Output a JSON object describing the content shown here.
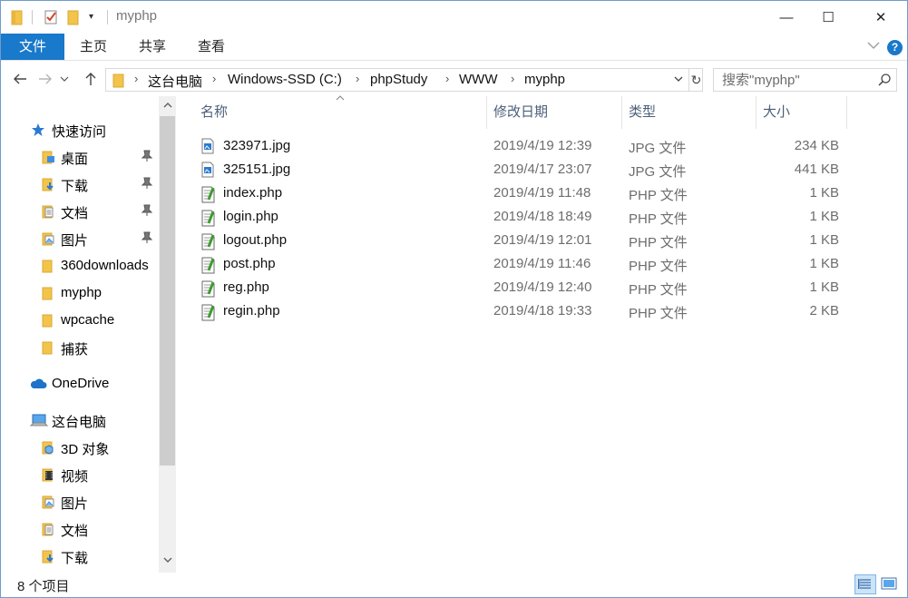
{
  "window": {
    "title": "myphp",
    "minimize_glyph": "—",
    "maximize_glyph": "☐",
    "close_glyph": "✕"
  },
  "ribbon": {
    "tabs": [
      "文件",
      "主页",
      "共享",
      "查看"
    ],
    "accent_color": "#1979ca",
    "help_glyph": "?"
  },
  "address": {
    "crumbs": [
      "这台电脑",
      "Windows-SSD (C:)",
      "phpStudy",
      "WWW",
      "myphp"
    ],
    "search_placeholder": "搜索\"myphp\""
  },
  "sidebar": {
    "quick_access": "快速访问",
    "quick_items": [
      {
        "label": "桌面",
        "icon": "desktop-folder-icon",
        "pinned": true
      },
      {
        "label": "下载",
        "icon": "downloads-folder-icon",
        "pinned": true
      },
      {
        "label": "文档",
        "icon": "documents-folder-icon",
        "pinned": true
      },
      {
        "label": "图片",
        "icon": "pictures-folder-icon",
        "pinned": true
      },
      {
        "label": "360downloads",
        "icon": "folder-icon",
        "pinned": false
      },
      {
        "label": "myphp",
        "icon": "folder-icon",
        "pinned": false
      },
      {
        "label": "wpcache",
        "icon": "folder-icon",
        "pinned": false
      },
      {
        "label": "捕获",
        "icon": "folder-icon",
        "pinned": false
      }
    ],
    "onedrive": "OneDrive",
    "this_pc": "这台电脑",
    "pc_items": [
      {
        "label": "3D 对象",
        "icon": "3d-objects-icon"
      },
      {
        "label": "视频",
        "icon": "videos-folder-icon"
      },
      {
        "label": "图片",
        "icon": "pictures-folder-icon"
      },
      {
        "label": "文档",
        "icon": "documents-folder-icon"
      },
      {
        "label": "下载",
        "icon": "downloads-folder-icon"
      }
    ]
  },
  "columns": {
    "name": "名称",
    "date": "修改日期",
    "type": "类型",
    "size": "大小"
  },
  "files": [
    {
      "name": "323971.jpg",
      "date": "2019/4/19 12:39",
      "type": "JPG 文件",
      "size": "234 KB",
      "kind": "image"
    },
    {
      "name": "325151.jpg",
      "date": "2019/4/17 23:07",
      "type": "JPG 文件",
      "size": "441 KB",
      "kind": "image"
    },
    {
      "name": "index.php",
      "date": "2019/4/19 11:48",
      "type": "PHP 文件",
      "size": "1 KB",
      "kind": "php"
    },
    {
      "name": "login.php",
      "date": "2019/4/18 18:49",
      "type": "PHP 文件",
      "size": "1 KB",
      "kind": "php"
    },
    {
      "name": "logout.php",
      "date": "2019/4/19 12:01",
      "type": "PHP 文件",
      "size": "1 KB",
      "kind": "php"
    },
    {
      "name": "post.php",
      "date": "2019/4/19 11:46",
      "type": "PHP 文件",
      "size": "1 KB",
      "kind": "php"
    },
    {
      "name": "reg.php",
      "date": "2019/4/19 12:40",
      "type": "PHP 文件",
      "size": "1 KB",
      "kind": "php"
    },
    {
      "name": "regin.php",
      "date": "2019/4/18 19:33",
      "type": "PHP 文件",
      "size": "2 KB",
      "kind": "php"
    }
  ],
  "status": {
    "item_count": "8 个项目"
  }
}
